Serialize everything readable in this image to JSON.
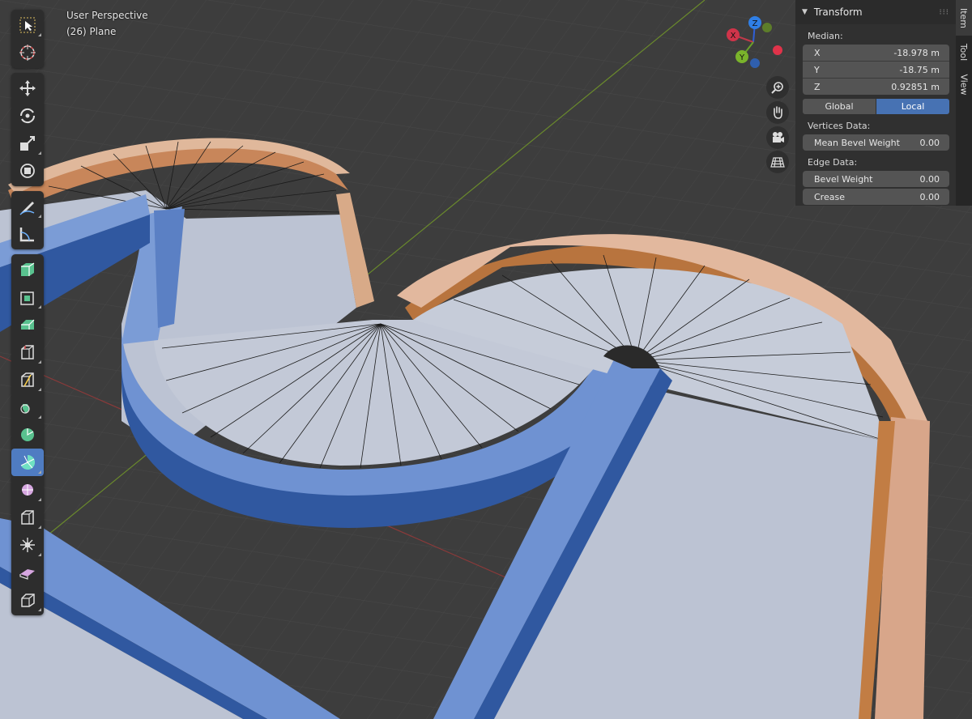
{
  "viewport": {
    "mode_label": "User Perspective",
    "object_label": "(26) Plane"
  },
  "gizmo": {
    "x_label": "X",
    "y_label": "Y",
    "z_label": "Z"
  },
  "toolbar": {
    "tools": [
      "select-box-icon",
      "cursor-icon",
      "move-icon",
      "rotate-icon",
      "scale-icon",
      "transform-icon",
      "annotate-icon",
      "measure-icon",
      "add-cube-icon",
      "extrude-region-icon",
      "inset-faces-icon",
      "bevel-icon",
      "loop-cut-icon",
      "knife-icon",
      "poly-build-icon",
      "spin-icon",
      "smooth-icon",
      "edge-slide-icon",
      "shrink-fatten-icon",
      "shear-icon",
      "rip-region-icon"
    ],
    "active_tool": "spin-icon"
  },
  "npanel": {
    "panel_title": "Transform",
    "median_label": "Median:",
    "x": {
      "label": "X",
      "value": "-18.978 m"
    },
    "y": {
      "label": "Y",
      "value": "-18.75 m"
    },
    "z": {
      "label": "Z",
      "value": "0.92851 m"
    },
    "global_label": "Global",
    "local_label": "Local",
    "vertices_data_label": "Vertices Data:",
    "mean_bevel": {
      "label": "Mean Bevel Weight",
      "value": "0.00"
    },
    "edge_data_label": "Edge Data:",
    "bevel_weight": {
      "label": "Bevel Weight",
      "value": "0.00"
    },
    "crease": {
      "label": "Crease",
      "value": "0.00"
    }
  },
  "sidetabs": {
    "item": "Item",
    "tool": "Tool",
    "view": "View"
  },
  "colors": {
    "background": "#3d3d3d",
    "grid": "#474747",
    "face": "#bcc3d3",
    "selected_wall_light": "#7b9cd6",
    "selected_wall_dark": "#3058a0",
    "wall_light": "#dcb49a",
    "wall_dark": "#b06e35",
    "active_tool": "#4f7cc2"
  }
}
